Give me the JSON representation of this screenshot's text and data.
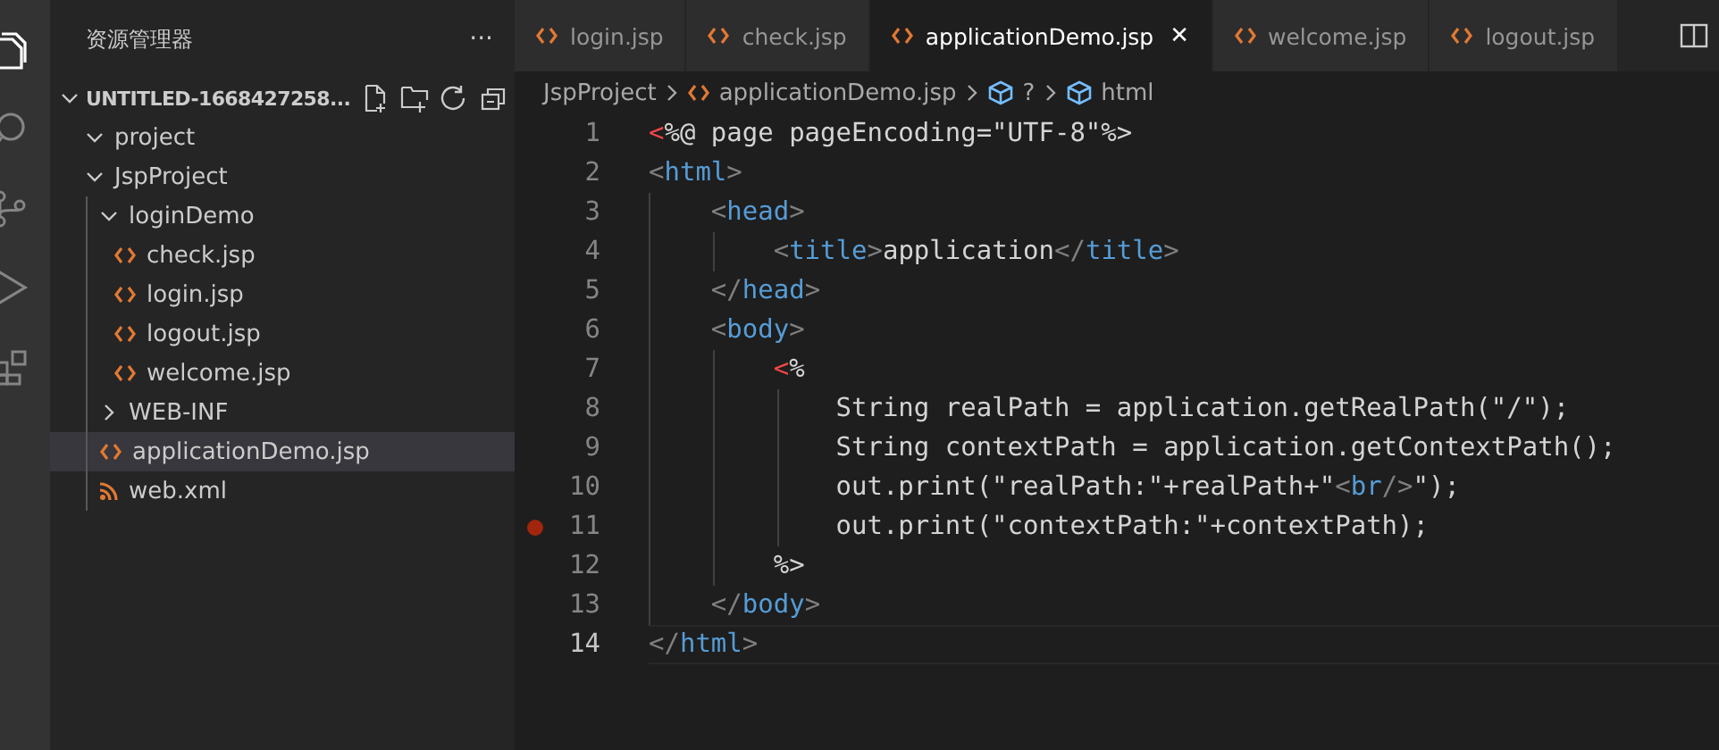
{
  "sidebar": {
    "title": "资源管理器",
    "more": "···",
    "root": {
      "label": "UNTITLED-1668427258...",
      "expanded": true,
      "children": [
        {
          "kind": "folder",
          "label": "project",
          "expanded": true,
          "selected": false
        },
        {
          "kind": "folder",
          "label": "JspProject",
          "expanded": true,
          "selected": false,
          "children": [
            {
              "kind": "folder",
              "label": "loginDemo",
              "expanded": true,
              "selected": false,
              "children": [
                {
                  "kind": "jsp",
                  "label": "check.jsp",
                  "selected": false
                },
                {
                  "kind": "jsp",
                  "label": "login.jsp",
                  "selected": false
                },
                {
                  "kind": "jsp",
                  "label": "logout.jsp",
                  "selected": false
                },
                {
                  "kind": "jsp",
                  "label": "welcome.jsp",
                  "selected": false
                }
              ]
            },
            {
              "kind": "folder",
              "label": "WEB-INF",
              "expanded": false,
              "selected": false
            },
            {
              "kind": "jsp",
              "label": "applicationDemo.jsp",
              "selected": true
            },
            {
              "kind": "xml",
              "label": "web.xml",
              "selected": false
            }
          ]
        }
      ]
    }
  },
  "tabs": [
    {
      "label": "login.jsp",
      "selected": false
    },
    {
      "label": "check.jsp",
      "selected": false
    },
    {
      "label": "applicationDemo.jsp",
      "selected": true,
      "close": "✕"
    },
    {
      "label": "welcome.jsp",
      "selected": false
    },
    {
      "label": "logout.jsp",
      "selected": false
    }
  ],
  "breadcrumbs": [
    {
      "kind": "folder",
      "label": "JspProject"
    },
    {
      "kind": "jsp",
      "label": "applicationDemo.jsp"
    },
    {
      "kind": "symbol",
      "label": "?"
    },
    {
      "kind": "symbol",
      "label": "html"
    }
  ],
  "code": [
    {
      "number": "1",
      "breakpoint": false,
      "current": false,
      "tokens": [
        {
          "kind": "jsp",
          "t": "<"
        },
        {
          "kind": "text",
          "t": "%@ page pageEncoding=\"UTF-8\"%>"
        }
      ]
    },
    {
      "number": "2",
      "breakpoint": false,
      "current": false,
      "tokens": [
        {
          "kind": "punct",
          "t": "<"
        },
        {
          "kind": "tag",
          "t": "html"
        },
        {
          "kind": "punct",
          "t": ">"
        }
      ]
    },
    {
      "number": "3",
      "breakpoint": false,
      "current": false,
      "tokens": [
        {
          "kind": "punct",
          "t": "    <"
        },
        {
          "kind": "tag",
          "t": "head"
        },
        {
          "kind": "punct",
          "t": ">"
        }
      ]
    },
    {
      "number": "4",
      "breakpoint": false,
      "current": false,
      "tokens": [
        {
          "kind": "punct",
          "t": "        <"
        },
        {
          "kind": "tag",
          "t": "title"
        },
        {
          "kind": "punct",
          "t": ">"
        },
        {
          "kind": "text",
          "t": "application"
        },
        {
          "kind": "punct",
          "t": "</"
        },
        {
          "kind": "tag",
          "t": "title"
        },
        {
          "kind": "punct",
          "t": ">"
        }
      ]
    },
    {
      "number": "5",
      "breakpoint": false,
      "current": false,
      "tokens": [
        {
          "kind": "punct",
          "t": "    </"
        },
        {
          "kind": "tag",
          "t": "head"
        },
        {
          "kind": "punct",
          "t": ">"
        }
      ]
    },
    {
      "number": "6",
      "breakpoint": false,
      "current": false,
      "tokens": [
        {
          "kind": "punct",
          "t": "    <"
        },
        {
          "kind": "tag",
          "t": "body"
        },
        {
          "kind": "punct",
          "t": ">"
        }
      ]
    },
    {
      "number": "7",
      "breakpoint": false,
      "current": false,
      "tokens": [
        {
          "kind": "jsp",
          "t": "        <"
        },
        {
          "kind": "text",
          "t": "%"
        }
      ]
    },
    {
      "number": "8",
      "breakpoint": false,
      "current": false,
      "tokens": [
        {
          "kind": "text",
          "t": "            String realPath = application.getRealPath(\"/\");"
        }
      ]
    },
    {
      "number": "9",
      "breakpoint": false,
      "current": false,
      "tokens": [
        {
          "kind": "text",
          "t": "            String contextPath = application.getContextPath();"
        }
      ]
    },
    {
      "number": "10",
      "breakpoint": false,
      "current": false,
      "tokens": [
        {
          "kind": "text",
          "t": "            out.print(\"realPath:\"+realPath+\""
        },
        {
          "kind": "punct",
          "t": "<"
        },
        {
          "kind": "tag",
          "t": "br"
        },
        {
          "kind": "punct",
          "t": "/>"
        },
        {
          "kind": "text",
          "t": "\");"
        }
      ]
    },
    {
      "number": "11",
      "breakpoint": true,
      "current": false,
      "tokens": [
        {
          "kind": "text",
          "t": "            out.print(\"contextPath:\"+contextPath);"
        }
      ]
    },
    {
      "number": "12",
      "breakpoint": false,
      "current": false,
      "tokens": [
        {
          "kind": "text",
          "t": "        %>"
        }
      ]
    },
    {
      "number": "13",
      "breakpoint": false,
      "current": false,
      "tokens": [
        {
          "kind": "punct",
          "t": "    </"
        },
        {
          "kind": "tag",
          "t": "body"
        },
        {
          "kind": "punct",
          "t": ">"
        }
      ]
    },
    {
      "number": "14",
      "breakpoint": false,
      "current": true,
      "tokens": [
        {
          "kind": "punct",
          "t": "</"
        },
        {
          "kind": "tag",
          "t": "html"
        },
        {
          "kind": "punct",
          "t": ">"
        }
      ]
    }
  ]
}
